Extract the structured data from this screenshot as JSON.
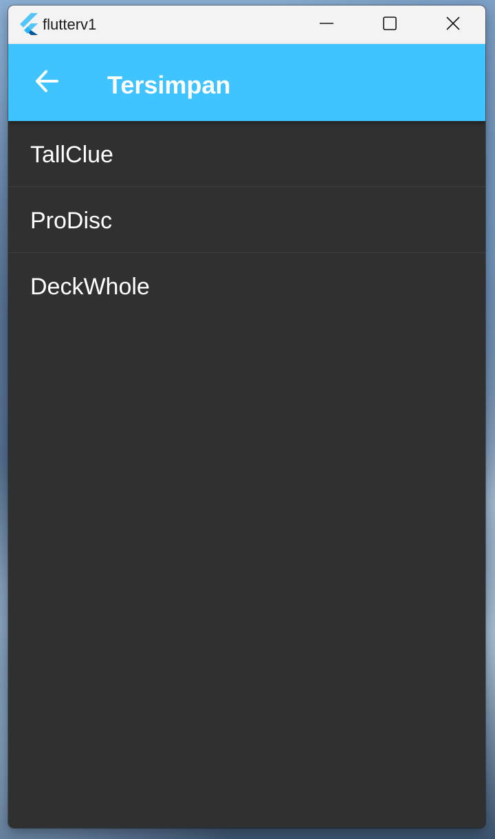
{
  "window": {
    "title": "flutterv1",
    "controls": {
      "minimize_icon": "minimize-icon",
      "maximize_icon": "maximize-icon",
      "close_icon": "close-icon"
    }
  },
  "appbar": {
    "title": "Tersimpan",
    "back_icon": "arrow-back-icon",
    "background": "#40c4ff"
  },
  "list": {
    "items": [
      {
        "label": "TallClue"
      },
      {
        "label": "ProDisc"
      },
      {
        "label": "DeckWhole"
      }
    ]
  },
  "colors": {
    "content_background": "#303030",
    "text": "#ffffff",
    "titlebar": "#f3f3f3"
  }
}
